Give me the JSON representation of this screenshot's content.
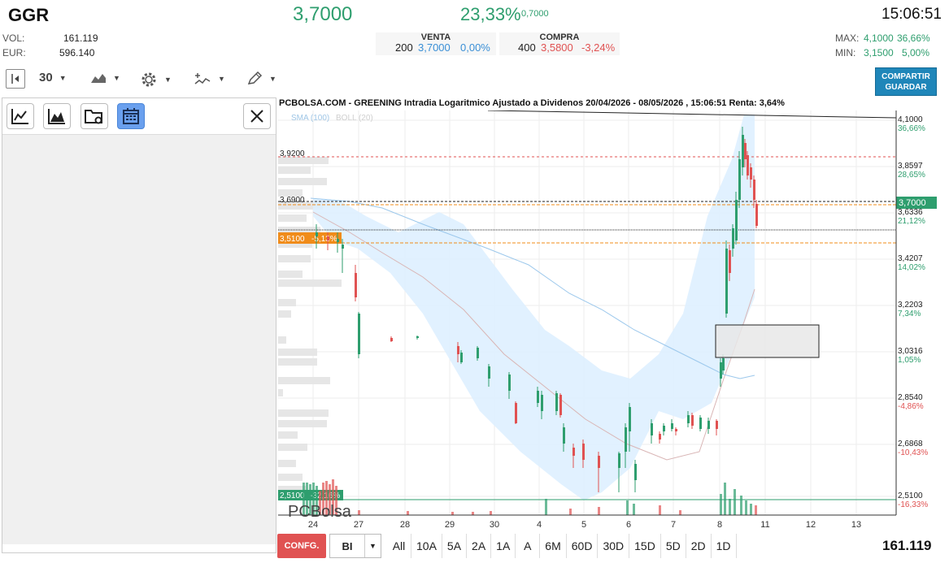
{
  "header": {
    "ticker": "GGR",
    "price": "3,7000",
    "change_pct": "23,33%",
    "change_abs": "0,7000",
    "time": "15:06:51"
  },
  "stats": {
    "vol_label": "VOL:",
    "vol_value": "161.119",
    "eur_label": "EUR:",
    "eur_value": "596.140",
    "max_label": "MAX:",
    "max_value": "4,1000",
    "max_pct": "36,66%",
    "min_label": "MIN:",
    "min_value": "3,1500",
    "min_pct": "5,00%"
  },
  "quotes": {
    "sell_label": "VENTA",
    "sell_qty": "200",
    "sell_price": "3,7000",
    "sell_pct": "0,00%",
    "buy_label": "COMPRA",
    "buy_qty": "400",
    "buy_price": "3,5800",
    "buy_pct": "-3,24%"
  },
  "toolbar": {
    "interval": "30",
    "share_label_1": "COMPARTIR",
    "share_label_2": "GUARDAR"
  },
  "chart": {
    "title": "PCBOLSA.COM - GREENING Intradia Logaritmico Ajustado a Dividenos 20/04/2026 - 08/05/2026 , 15:06:51 Renta: 3,64%",
    "legend_sma": "SMA (100)",
    "legend_boll": "BOLL (20)",
    "watermark": "PCBolsa",
    "left_labels": [
      "3,9200",
      "3,6900"
    ],
    "orange_label": "3,5100",
    "orange_pct": "-5,13%",
    "green_label": "2,5100",
    "green_pct": "-32,16%",
    "current_price_tag": "3,7000",
    "x_ticks": [
      "24",
      "27",
      "28",
      "29",
      "30",
      "4",
      "5",
      "6",
      "7",
      "8",
      "11",
      "12",
      "13"
    ],
    "y_ticks": [
      {
        "value": "4,1000",
        "pct": "36,66%",
        "dir": "up"
      },
      {
        "value": "3,8597",
        "pct": "28,65%",
        "dir": "up"
      },
      {
        "value": "3,6336",
        "pct": "21,12%",
        "dir": "up"
      },
      {
        "value": "3,4207",
        "pct": "14,02%",
        "dir": "up"
      },
      {
        "value": "3,2203",
        "pct": "7,34%",
        "dir": "up"
      },
      {
        "value": "3,0316",
        "pct": "1,05%",
        "dir": "up"
      },
      {
        "value": "2,8540",
        "pct": "-4,86%",
        "dir": "down"
      },
      {
        "value": "2,6868",
        "pct": "-10,43%",
        "dir": "down"
      },
      {
        "value": "2,5100",
        "pct": "-16,33%",
        "dir": "down"
      }
    ]
  },
  "bottom_bar": {
    "config_label": "CONFG.",
    "bi_label": "BI",
    "timeframes": [
      "All",
      "10A",
      "5A",
      "2A",
      "1A",
      "A",
      "6M",
      "60D",
      "30D",
      "15D",
      "5D",
      "2D",
      "1D"
    ],
    "total_volume": "161.119"
  },
  "colors": {
    "up": "#2e9e6e",
    "down": "#e05252",
    "accent": "#1f86b9",
    "orange": "#f08c1a",
    "band": "#dbeefa"
  }
}
